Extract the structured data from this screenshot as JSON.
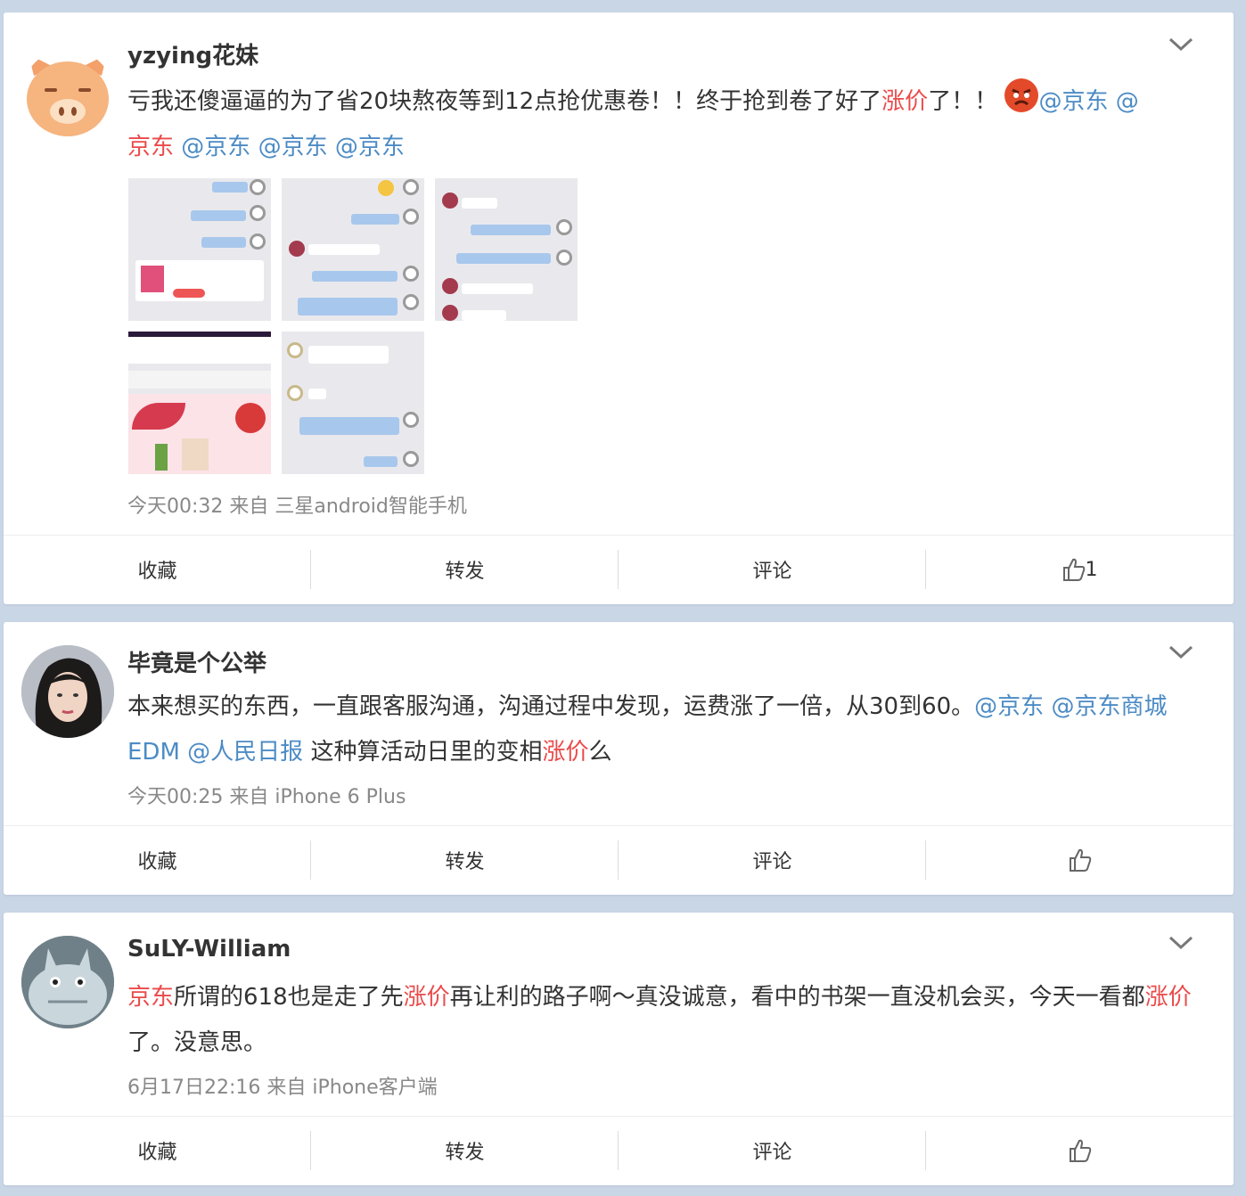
{
  "posts": [
    {
      "username": "yzying花妹",
      "avatar": "pig-avatar",
      "text_parts": [
        {
          "t": "亏我还傻逼逼的为了省20块熬夜等到12点抢优惠卷！！终于抢到卷了好了",
          "c": ""
        },
        {
          "t": "涨价",
          "c": "red"
        },
        {
          "t": "了！！",
          "c": ""
        },
        {
          "t": "@京东 @京东 @京东 @京东 @京东",
          "c": "mention"
        }
      ],
      "meta": "今天00:32 来自 三星android智能手机",
      "actions": {
        "favorite": "收藏",
        "repost": "转发",
        "comment": "评论",
        "like_count": "1"
      }
    },
    {
      "username": "毕竟是个公举",
      "avatar": "woman-avatar",
      "meta": "今天00:25 来自 iPhone 6 Plus",
      "actions": {
        "favorite": "收藏",
        "repost": "转发",
        "comment": "评论",
        "like_count": ""
      }
    },
    {
      "username": "SuLY-William",
      "avatar": "totoro-avatar",
      "meta": "6月17日22:16 来自 iPhone客户端",
      "actions": {
        "favorite": "收藏",
        "repost": "转发",
        "comment": "评论",
        "like_count": ""
      }
    }
  ],
  "text": {
    "p1_a": "亏我还傻逼逼的为了省20块熬夜等到12点抢优惠卷！！终于抢到卷了好了",
    "p1_b": "涨价",
    "p1_c": "了！！",
    "p1_m1": "@京东",
    "p1_m2": "@",
    "p1_m2b": "京东",
    "p1_m3": "@京东",
    "p1_m4": "@京东",
    "p1_m5": "@京东",
    "p2_a": "本来想买的东西，一直跟客服沟通，沟通过程中发现，运费涨了一倍，从30到60。",
    "p2_m1": "@京东",
    "p2_m2": "@京东商城EDM",
    "p2_m3": "@人民日报",
    "p2_b": "这种算活动日里的变相",
    "p2_c": "涨价",
    "p2_d": "么",
    "p3_a": "京东",
    "p3_b": "所谓的618也是走了先",
    "p3_c": "涨价",
    "p3_d": "再让利的路子啊～真没诚意，看中的书架一直没机会买，今天一看都",
    "p3_e": "涨价",
    "p3_f": "了。没意思。"
  },
  "colors": {
    "highlight_red": "#eb4a4a",
    "mention_blue": "#4c8bc5",
    "page_bg": "#c9d6e6"
  }
}
